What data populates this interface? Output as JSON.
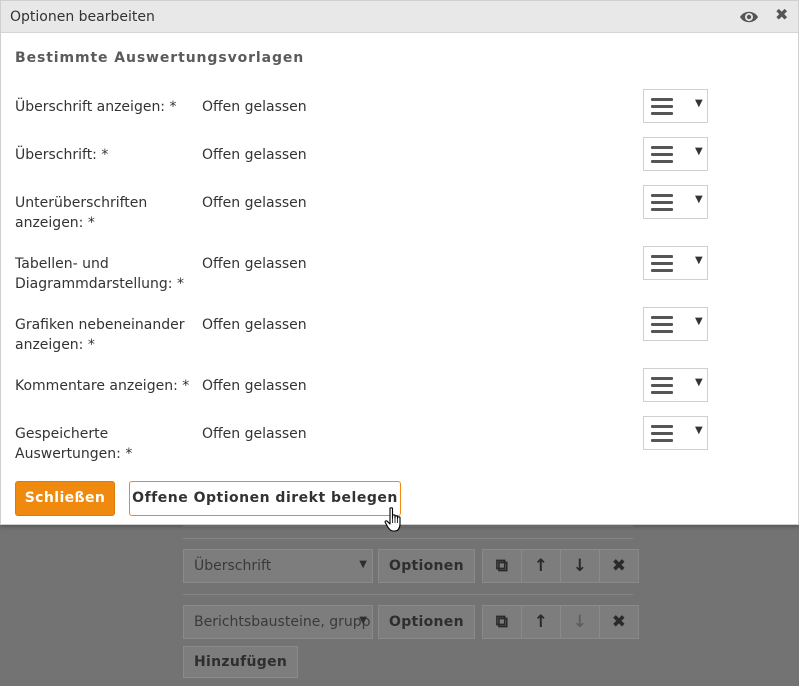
{
  "dialog": {
    "title": "Optionen bearbeiten",
    "icons": {
      "view": "eye-icon",
      "close": "close-icon"
    },
    "close_glyph": "✖",
    "section_title": "Bestimmte Auswertungsvorlagen",
    "options": [
      {
        "label": "Überschrift anzeigen: *",
        "value": "Offen gelassen"
      },
      {
        "label": "Überschrift: *",
        "value": "Offen gelassen"
      },
      {
        "label": "Unterüberschriften anzeigen: *",
        "value": "Offen gelassen"
      },
      {
        "label": "Tabellen- und Diagrammdarstellung: *",
        "value": "Offen gelassen"
      },
      {
        "label": "Grafiken nebeneinander anzeigen: *",
        "value": "Offen gelassen"
      },
      {
        "label": "Kommentare anzeigen: *",
        "value": "Offen gelassen"
      },
      {
        "label": "Gespeicherte Auswertungen: *",
        "value": "Offen gelassen"
      }
    ],
    "caret_glyph": "▼",
    "buttons": {
      "close": "Schließen",
      "fill_open": "Offene Optionen direkt belegen"
    }
  },
  "background": {
    "rows": [
      {
        "select": "Überschrift",
        "button": "Optionen"
      },
      {
        "select": "Berichtsbausteine, grupp",
        "button": "Optionen"
      }
    ],
    "add_button": "Hinzufügen",
    "icon_glyphs": {
      "copy": "⧉",
      "up": "↑",
      "down": "↓",
      "delete": "✖"
    }
  },
  "colors": {
    "accent": "#ef8a0e",
    "overlay": "#737373"
  }
}
